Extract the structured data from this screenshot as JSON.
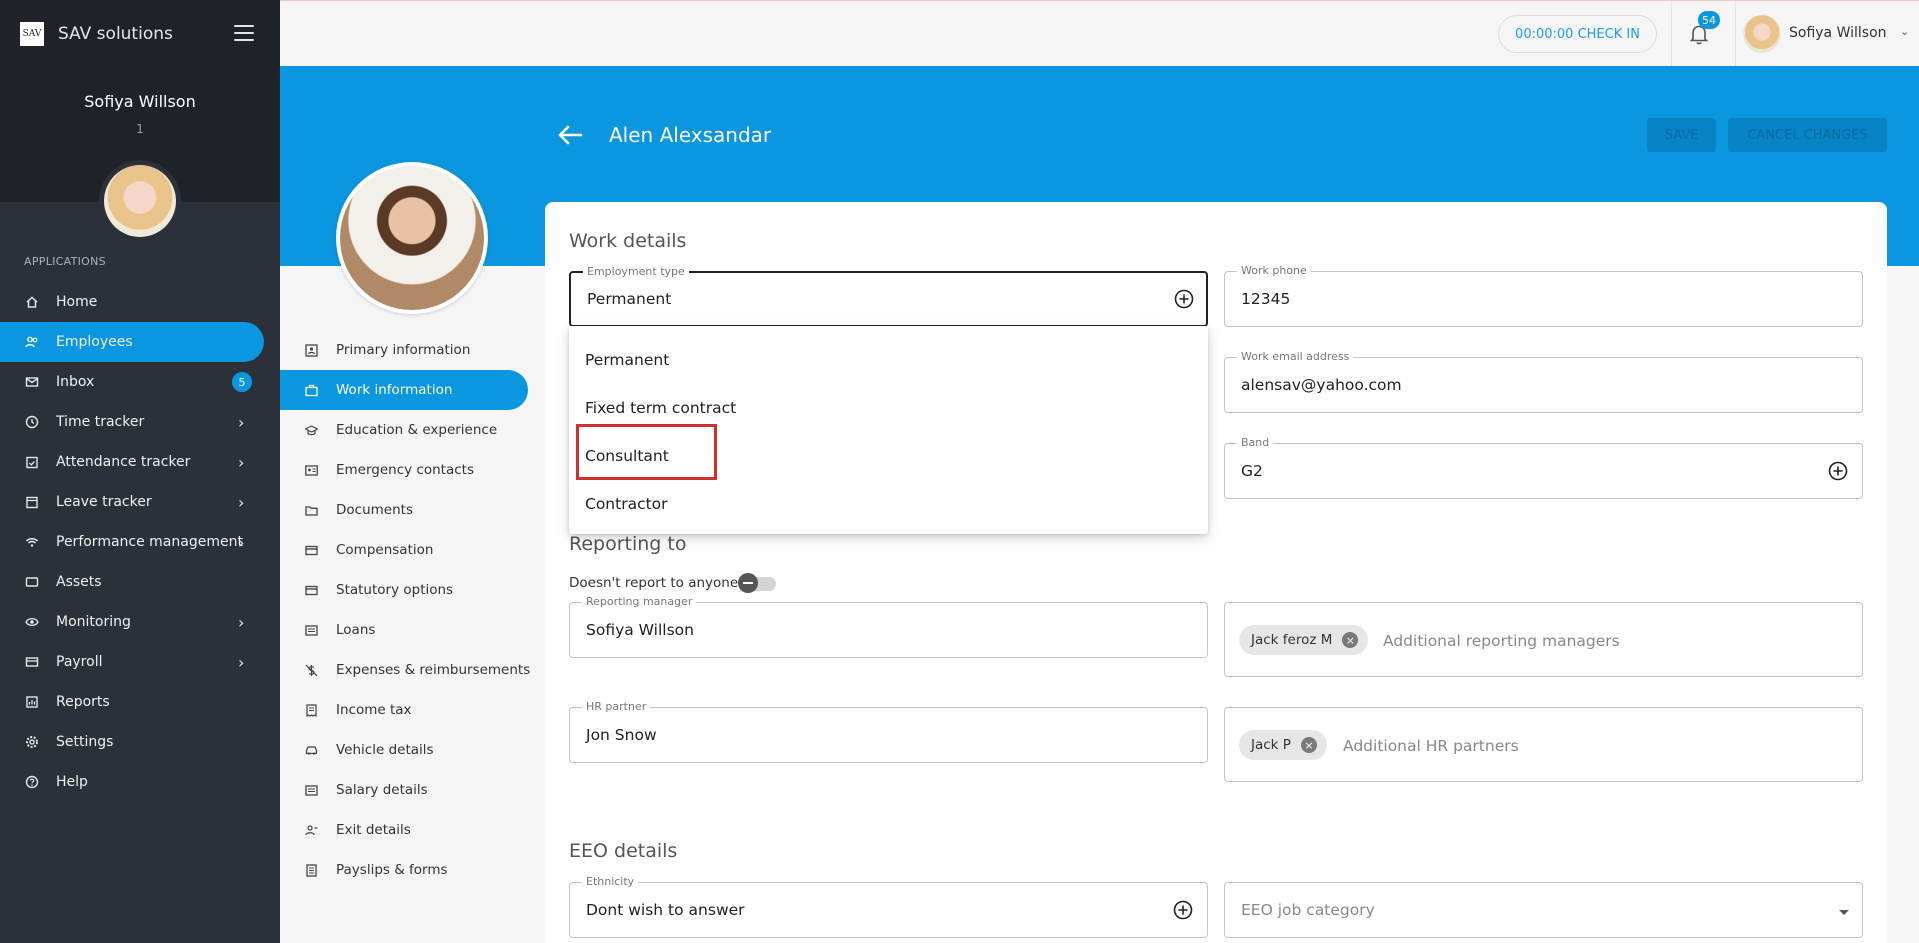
{
  "brand": {
    "logo": "SAV",
    "name": "SAV solutions"
  },
  "sidebar": {
    "user_name": "Sofiya Willson",
    "user_id": "1",
    "apps_label": "APPLICATIONS",
    "items": [
      {
        "label": "Home",
        "icon": "home-icon"
      },
      {
        "label": "Employees",
        "icon": "users-icon"
      },
      {
        "label": "Inbox",
        "icon": "mail-icon",
        "badge": "5"
      },
      {
        "label": "Time tracker",
        "icon": "clock-icon"
      },
      {
        "label": "Attendance tracker",
        "icon": "calendar-check-icon"
      },
      {
        "label": "Leave tracker",
        "icon": "calendar-icon"
      },
      {
        "label": "Performance management",
        "icon": "wifi-icon"
      },
      {
        "label": "Assets",
        "icon": "monitor-icon"
      },
      {
        "label": "Monitoring",
        "icon": "eye-icon"
      },
      {
        "label": "Payroll",
        "icon": "wallet-icon"
      },
      {
        "label": "Reports",
        "icon": "report-icon"
      },
      {
        "label": "Settings",
        "icon": "gear-icon"
      },
      {
        "label": "Help",
        "icon": "help-icon"
      }
    ]
  },
  "topbar": {
    "checkin_label": "00:00:00 CHECK IN",
    "notification_count": "54",
    "user_name": "Sofiya Willson"
  },
  "header": {
    "employee_name": "Alen Alexsandar",
    "save_label": "SAVE",
    "cancel_label": "CANCEL CHANGES"
  },
  "subnav": {
    "items": [
      {
        "label": "Primary information"
      },
      {
        "label": "Work information"
      },
      {
        "label": "Education & experience"
      },
      {
        "label": "Emergency contacts"
      },
      {
        "label": "Documents"
      },
      {
        "label": "Compensation"
      },
      {
        "label": "Statutory options"
      },
      {
        "label": "Loans"
      },
      {
        "label": "Expenses & reimbursements"
      },
      {
        "label": "Income tax"
      },
      {
        "label": "Vehicle details"
      },
      {
        "label": "Salary details"
      },
      {
        "label": "Exit details"
      },
      {
        "label": "Payslips & forms"
      }
    ]
  },
  "work_details": {
    "title": "Work details",
    "employment_type": {
      "label": "Employment type",
      "value": "Permanent"
    },
    "work_phone": {
      "label": "Work phone",
      "value": "12345"
    },
    "work_email": {
      "label": "Work email address",
      "value": "alensav@yahoo.com"
    },
    "band": {
      "label": "Band",
      "value": "G2"
    },
    "employment_options": [
      "Permanent",
      "Fixed term contract",
      "Consultant",
      "Contractor"
    ]
  },
  "reporting": {
    "title": "Reporting to",
    "no_report_label": "Doesn't report to anyone",
    "manager": {
      "label": "Reporting manager",
      "value": "Sofiya Willson"
    },
    "additional_managers": {
      "chip": "Jack feroz M",
      "placeholder": "Additional reporting managers"
    },
    "hr_partner": {
      "label": "HR partner",
      "value": "Jon Snow"
    },
    "additional_hr": {
      "chip": "Jack P",
      "placeholder": "Additional HR partners"
    }
  },
  "eeo": {
    "title": "EEO details",
    "ethnicity": {
      "label": "Ethnicity",
      "value": "Dont wish to answer"
    },
    "job_category": {
      "placeholder": "EEO job category"
    }
  },
  "colors": {
    "accent": "#0a97e0",
    "sidebar": "#2b3039",
    "highlight": "#d32f2f"
  }
}
